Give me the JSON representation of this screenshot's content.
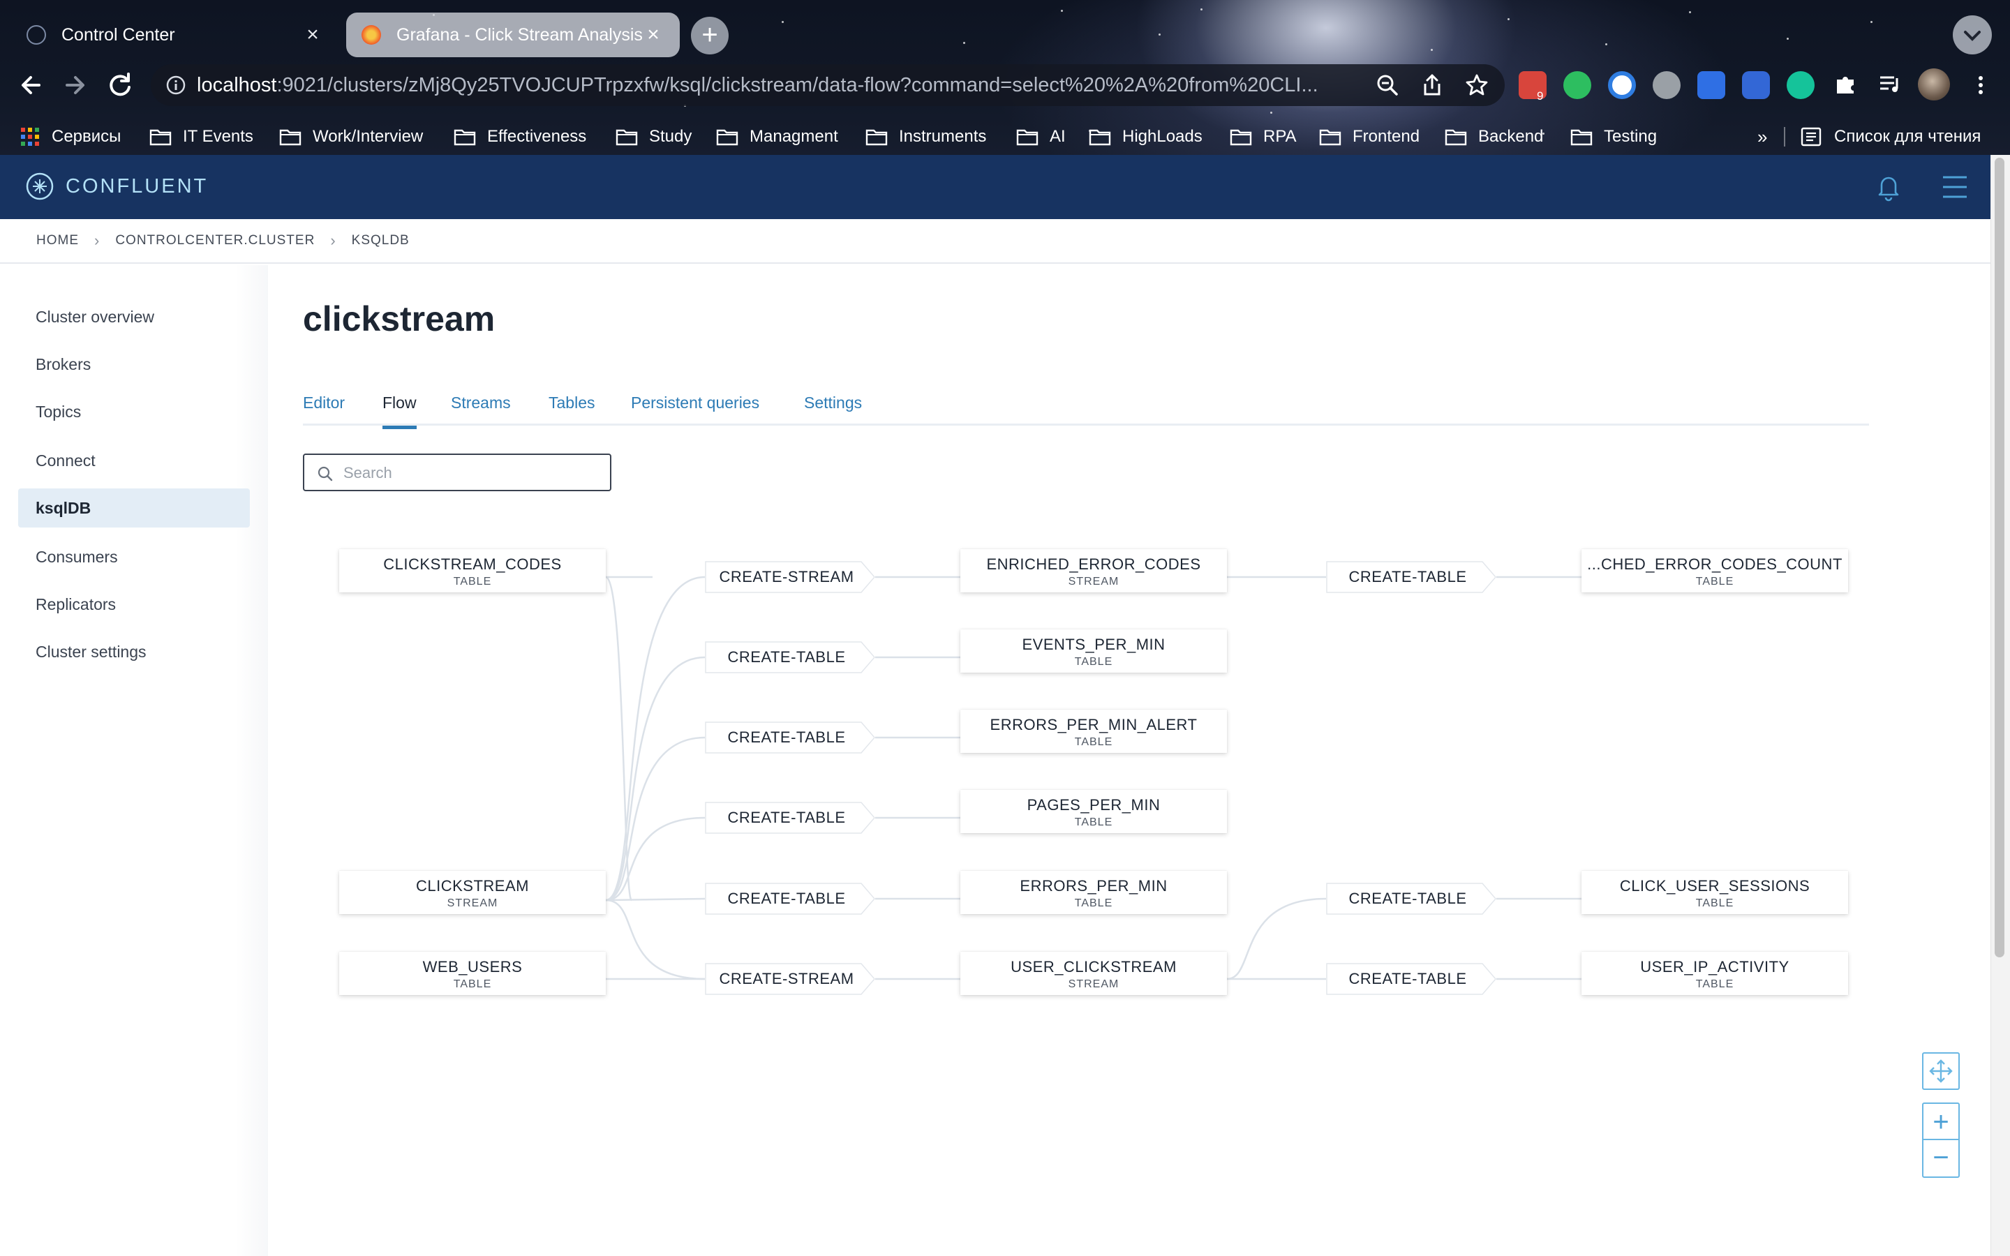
{
  "browser": {
    "tabs": [
      {
        "title": "Control Center",
        "close": "×"
      },
      {
        "title": "Grafana - Click Stream Analysis",
        "close": "×"
      }
    ],
    "new_tab": "+",
    "url": {
      "host": "localhost",
      "rest": ":9021/clusters/zMj8Qy25TVOJCUPTrpzxfw/ksql/clickstream/data-flow?command=select%20%2A%20from%20CLI..."
    },
    "extension_badge": "9",
    "bookmarks": [
      {
        "label": "Сервисы"
      },
      {
        "label": "IT Events"
      },
      {
        "label": "Work/Interview"
      },
      {
        "label": "Effectiveness"
      },
      {
        "label": "Study"
      },
      {
        "label": "Managment"
      },
      {
        "label": "Instruments"
      },
      {
        "label": "AI"
      },
      {
        "label": "HighLoads"
      },
      {
        "label": "RPA"
      },
      {
        "label": "Frontend"
      },
      {
        "label": "Backend"
      },
      {
        "label": "Testing"
      }
    ],
    "more_bookmarks": "»",
    "reading_list": "Список для чтения"
  },
  "app": {
    "brand": "CONFLUENT",
    "breadcrumb": [
      "HOME",
      "CONTROLCENTER.CLUSTER",
      "KSQLDB"
    ],
    "sidebar": [
      {
        "label": "Cluster overview"
      },
      {
        "label": "Brokers"
      },
      {
        "label": "Topics"
      },
      {
        "label": "Connect"
      },
      {
        "label": "ksqlDB",
        "active": true
      },
      {
        "label": "Consumers"
      },
      {
        "label": "Replicators"
      },
      {
        "label": "Cluster settings"
      }
    ],
    "title": "clickstream",
    "tabs": [
      {
        "label": "Editor"
      },
      {
        "label": "Flow",
        "active": true
      },
      {
        "label": "Streams"
      },
      {
        "label": "Tables"
      },
      {
        "label": "Persistent queries"
      },
      {
        "label": "Settings"
      }
    ],
    "search": {
      "placeholder": "Search",
      "value": ""
    }
  },
  "flow": {
    "sources": [
      {
        "name": "CLICKSTREAM_CODES",
        "type": "TABLE"
      },
      {
        "name": "CLICKSTREAM",
        "type": "STREAM"
      },
      {
        "name": "WEB_USERS",
        "type": "TABLE"
      }
    ],
    "ops1": [
      "CREATE-STREAM",
      "CREATE-TABLE",
      "CREATE-TABLE",
      "CREATE-TABLE",
      "CREATE-TABLE",
      "CREATE-STREAM"
    ],
    "mid": [
      {
        "name": "ENRICHED_ERROR_CODES",
        "type": "STREAM"
      },
      {
        "name": "EVENTS_PER_MIN",
        "type": "TABLE"
      },
      {
        "name": "ERRORS_PER_MIN_ALERT",
        "type": "TABLE"
      },
      {
        "name": "PAGES_PER_MIN",
        "type": "TABLE"
      },
      {
        "name": "ERRORS_PER_MIN",
        "type": "TABLE"
      },
      {
        "name": "USER_CLICKSTREAM",
        "type": "STREAM"
      }
    ],
    "ops2": [
      "CREATE-TABLE",
      "CREATE-TABLE",
      "CREATE-TABLE"
    ],
    "outputs": [
      {
        "name": "...CHED_ERROR_CODES_COUNT",
        "type": "TABLE"
      },
      {
        "name": "CLICK_USER_SESSIONS",
        "type": "TABLE"
      },
      {
        "name": "USER_IP_ACTIVITY",
        "type": "TABLE"
      }
    ]
  },
  "controls": {
    "zoom_in": "+",
    "zoom_out": "−"
  }
}
